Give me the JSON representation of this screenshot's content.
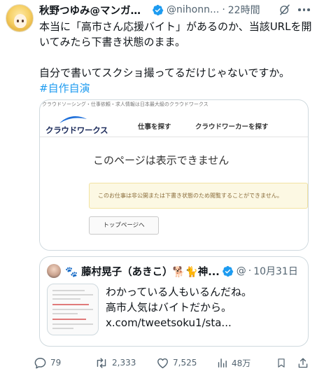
{
  "author": {
    "display_name": "秋野つゆみ@マンガ・...",
    "handle": "@nihonn...",
    "separator": "·",
    "time": "22時間"
  },
  "tweet": {
    "line1": "本当に「高市さん応援バイト」があるのか、当該URLを開いてみたら下書き状態のまま。",
    "line2": "自分で書いてスクショ撮ってるだけじゃないですか。",
    "hashtag": "#自作自演"
  },
  "screenshot": {
    "topbar": "クラウドソーシング・仕事依頼・求人情報は日本最大級のクラウドワークス",
    "logo_text": "クラウドワークス",
    "nav_find_job": "仕事を探す",
    "nav_find_worker": "クラウドワーカーを探す",
    "title": "このページは表示できません",
    "notice": "このお仕事は非公開または下書き状態のため閲覧することができません。",
    "button": "トップページへ"
  },
  "quoted": {
    "display_name": "🐾 藤村晃子（あきこ）🐕🐈神...",
    "handle": "@...",
    "separator": "·",
    "time": "10月31日",
    "text_line1": "わかっている人もいるんだね。",
    "text_line2": "高市人気はバイトだから。",
    "text_line3": "x.com/tweetsoku1/sta..."
  },
  "actions": {
    "replies": "79",
    "reposts": "2,333",
    "likes": "7,525",
    "views": "48万"
  },
  "colors": {
    "text": "#0f1419",
    "secondary": "#536471",
    "link": "#1d9bf0",
    "border": "#cfd9de",
    "verified": "#1d9bf0"
  }
}
